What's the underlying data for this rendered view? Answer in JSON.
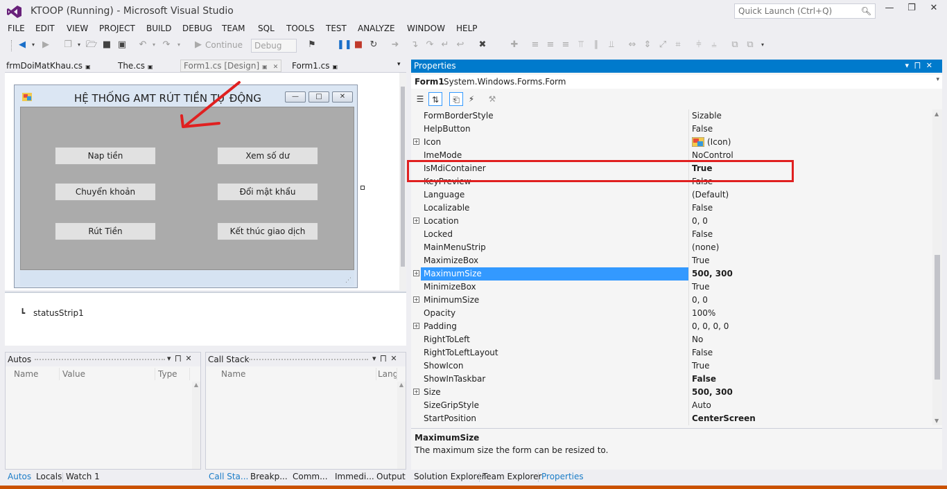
{
  "window": {
    "title": "KTOOP (Running) - Microsoft Visual Studio",
    "quick_launch_placeholder": "Quick Launch (Ctrl+Q)"
  },
  "menu": [
    "FILE",
    "EDIT",
    "VIEW",
    "PROJECT",
    "BUILD",
    "DEBUG",
    "TEAM",
    "SQL",
    "TOOLS",
    "TEST",
    "ANALYZE",
    "WINDOW",
    "HELP"
  ],
  "toolbar": {
    "continue_label": "Continue",
    "configuration": "Debug"
  },
  "doc_tabs": [
    {
      "label": "frmDoiMatKhau.cs"
    },
    {
      "label": "The.cs"
    },
    {
      "label": "Form1.cs [Design]"
    },
    {
      "label": "Form1.cs"
    }
  ],
  "designer": {
    "form_title": "HỆ THỐNG AMT RÚT TIỀN TỰ ĐỘNG",
    "buttons": [
      "Nap tiền",
      "Xem số dư",
      "Chuyển khoản",
      "Đổi mật khẩu",
      "Rút Tiền",
      "Kết thúc giao dịch"
    ],
    "tray_component": "statusStrip1"
  },
  "autos_pane": {
    "title": "Autos",
    "columns": [
      "Name",
      "Value",
      "Type"
    ]
  },
  "callstack_pane": {
    "title": "Call Stack",
    "columns": [
      "Name",
      "Lang"
    ]
  },
  "bottom_tabs_left": [
    "Autos",
    "Locals",
    "Watch 1",
    "Call Sta...",
    "Breakp...",
    "Comm...",
    "Immedi...",
    "Output"
  ],
  "bottom_tabs_right": [
    "Solution Explorer",
    "Team Explorer",
    "Properties"
  ],
  "properties": {
    "title": "Properties",
    "object_name": "Form1",
    "object_type": "System.Windows.Forms.Form",
    "rows": [
      {
        "name": "FormBorderStyle",
        "value": "Sizable",
        "bold": false,
        "expand": false
      },
      {
        "name": "HelpButton",
        "value": "False",
        "bold": false,
        "expand": false
      },
      {
        "name": "Icon",
        "value": "(Icon)",
        "bold": false,
        "expand": true
      },
      {
        "name": "ImeMode",
        "value": "NoControl",
        "bold": false,
        "expand": false
      },
      {
        "name": "IsMdiContainer",
        "value": "True",
        "bold": true,
        "expand": false
      },
      {
        "name": "KeyPreview",
        "value": "False",
        "bold": false,
        "expand": false
      },
      {
        "name": "Language",
        "value": "(Default)",
        "bold": false,
        "expand": false
      },
      {
        "name": "Localizable",
        "value": "False",
        "bold": false,
        "expand": false
      },
      {
        "name": "Location",
        "value": "0, 0",
        "bold": false,
        "expand": true
      },
      {
        "name": "Locked",
        "value": "False",
        "bold": false,
        "expand": false
      },
      {
        "name": "MainMenuStrip",
        "value": "(none)",
        "bold": false,
        "expand": false
      },
      {
        "name": "MaximizeBox",
        "value": "True",
        "bold": false,
        "expand": false
      },
      {
        "name": "MaximumSize",
        "value": "500, 300",
        "bold": true,
        "expand": true,
        "selected": true
      },
      {
        "name": "MinimizeBox",
        "value": "True",
        "bold": false,
        "expand": false
      },
      {
        "name": "MinimumSize",
        "value": "0, 0",
        "bold": false,
        "expand": true
      },
      {
        "name": "Opacity",
        "value": "100%",
        "bold": false,
        "expand": false
      },
      {
        "name": "Padding",
        "value": "0, 0, 0, 0",
        "bold": false,
        "expand": true
      },
      {
        "name": "RightToLeft",
        "value": "No",
        "bold": false,
        "expand": false
      },
      {
        "name": "RightToLeftLayout",
        "value": "False",
        "bold": false,
        "expand": false
      },
      {
        "name": "ShowIcon",
        "value": "True",
        "bold": false,
        "expand": false
      },
      {
        "name": "ShowInTaskbar",
        "value": "False",
        "bold": true,
        "expand": false
      },
      {
        "name": "Size",
        "value": "500, 300",
        "bold": true,
        "expand": true
      },
      {
        "name": "SizeGripStyle",
        "value": "Auto",
        "bold": false,
        "expand": false
      },
      {
        "name": "StartPosition",
        "value": "CenterScreen",
        "bold": true,
        "expand": false
      }
    ],
    "description_title": "MaximumSize",
    "description_text": "The maximum size the form can be resized to."
  },
  "colors": {
    "accent": "#007acc",
    "selection": "#3399ff",
    "annotation": "#e02020",
    "status_bar": "#ca5100"
  }
}
